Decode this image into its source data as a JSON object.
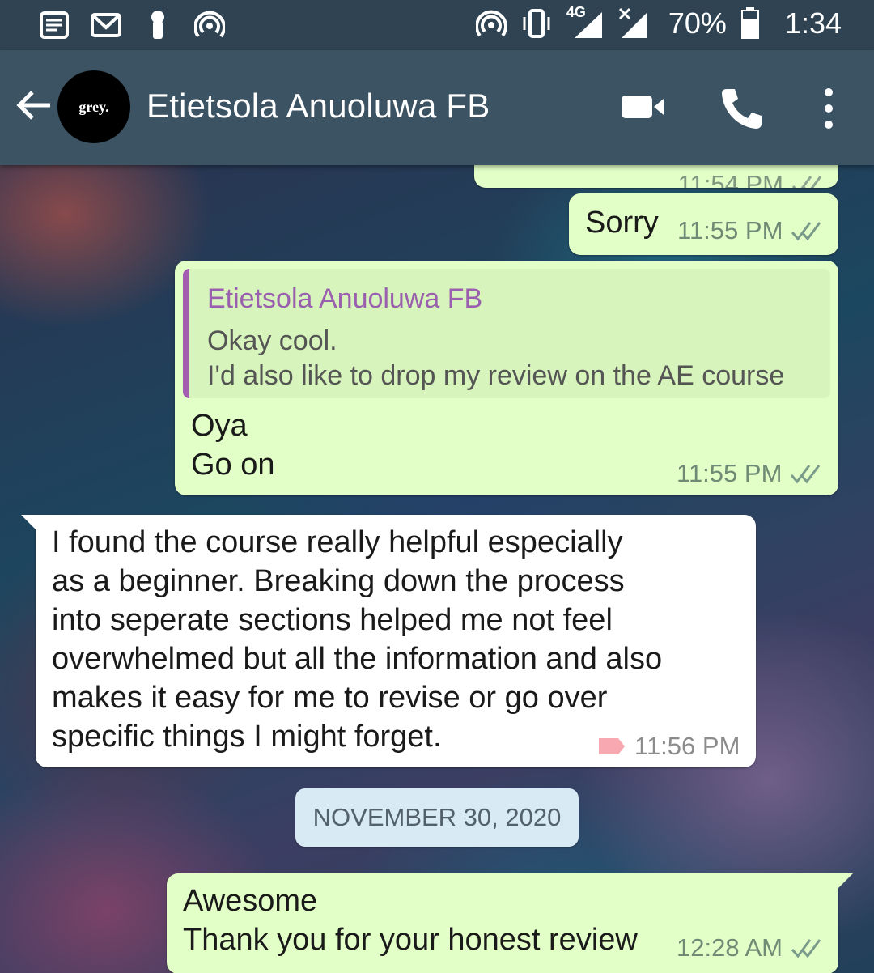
{
  "status_bar": {
    "left_icons": [
      "notes-icon",
      "gmail-icon",
      "keyhole-icon",
      "hotspot-icon"
    ],
    "right_icons": [
      "hotspot-icon",
      "vibrate-icon",
      "signal-4g-icon",
      "signal-no-icon"
    ],
    "network": "4G",
    "battery": "70%",
    "time": "1:34"
  },
  "header": {
    "avatar_text": "grey.",
    "contact_name": "Etietsola Anuoluwa FB",
    "icons": [
      "back-arrow-icon",
      "video-call-icon",
      "phone-icon",
      "more-vert-icon"
    ]
  },
  "messages": [
    {
      "direction": "out",
      "partial": true,
      "time": "11:54 PM"
    },
    {
      "direction": "out",
      "text": "Sorry",
      "time": "11:55 PM"
    },
    {
      "direction": "out",
      "quote": {
        "author": "Etietsola Anuoluwa FB",
        "line1": "Okay cool.",
        "line2": "I'd also like to drop my review on the AE course"
      },
      "line1": "Oya",
      "line2": "Go on",
      "time": "11:55 PM"
    },
    {
      "direction": "in",
      "lines": [
        "I found the course really helpful especially",
        "as a beginner. Breaking down the process",
        "into seperate sections helped me not feel",
        "overwhelmed but all the information and also",
        "makes it easy for me to revise or go over",
        "specific things I might forget."
      ],
      "time": "11:56 PM"
    },
    {
      "date_divider": "NOVEMBER 30, 2020"
    },
    {
      "direction": "out",
      "line1": "Awesome",
      "line2": "Thank you for your honest review",
      "time": "12:28 AM"
    }
  ],
  "colors": {
    "header": "#3b5363",
    "status_bar": "#2f4352",
    "outgoing_bubble": "#e2ffc7",
    "incoming_bubble": "#ffffff",
    "quote_accent": "#a25fb0",
    "read_ticks": "#7a9a8a"
  }
}
